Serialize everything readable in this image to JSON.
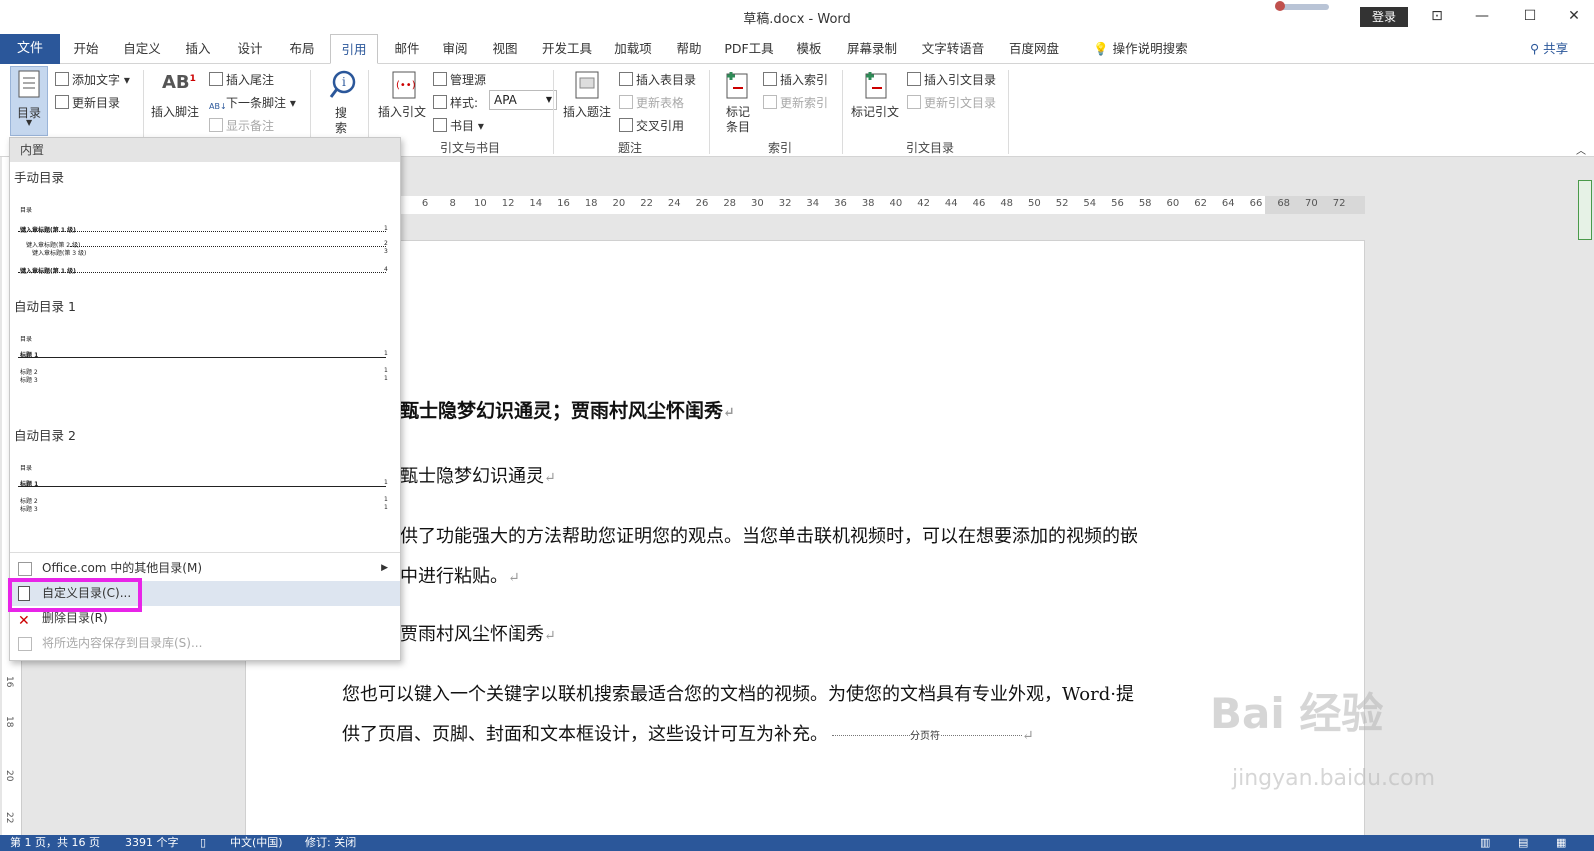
{
  "window": {
    "title": "草稿.docx  -  Word",
    "login": "登录"
  },
  "tabs": [
    "文件",
    "开始",
    "自定义",
    "插入",
    "设计",
    "布局",
    "引用",
    "邮件",
    "审阅",
    "视图",
    "开发工具",
    "加载项",
    "帮助",
    "PDF工具",
    "模板",
    "屏幕录制",
    "文字转语音",
    "百度网盘",
    "操作说明搜索"
  ],
  "share": "共享",
  "ribbon": {
    "toc_btn": "目录",
    "add_text": "添加文字",
    "update_toc": "更新目录",
    "insert_footnote": "插入脚注",
    "insert_endnote": "插入尾注",
    "next_footnote": "下一条脚注",
    "show_notes": "显示备注",
    "search_l1": "搜",
    "search_l2": "索",
    "insert_citation": "插入引文",
    "manage_sources": "管理源",
    "style_label": "样式:",
    "style_value": "APA",
    "bibliography": "书目",
    "group_citations": "引文与书目",
    "insert_caption": "插入题注",
    "insert_table_figures": "插入表目录",
    "update_table": "更新表格",
    "cross_ref": "交叉引用",
    "group_captions": "题注",
    "mark_entry_l1": "标记",
    "mark_entry_l2": "条目",
    "insert_index": "插入索引",
    "update_index": "更新索引",
    "group_index": "索引",
    "mark_citation": "标记引文",
    "insert_toa": "插入引文目录",
    "update_toa": "更新引文目录",
    "group_toa": "引文目录"
  },
  "ruler": {
    "ticks": [
      "6",
      "8",
      "10",
      "12",
      "14",
      "16",
      "18",
      "20",
      "22",
      "24",
      "26",
      "28",
      "30",
      "32",
      "34",
      "36",
      "38",
      "40",
      "42",
      "44",
      "46",
      "48",
      "50",
      "52",
      "54",
      "56",
      "58",
      "60",
      "62",
      "64",
      "66",
      "68",
      "70",
      "72"
    ]
  },
  "vruler": [
    "16",
    "18",
    "20",
    "22"
  ],
  "document": {
    "heading1": "甄士隐梦幻识通灵；贾雨村风尘怀闺秀",
    "heading2a": "甄士隐梦幻识通灵",
    "para1_line1": "供了功能强大的方法帮助您证明您的观点。当您单击联机视频时，可以在想要添加的视频的嵌",
    "para1_line2": "中进行粘贴。",
    "heading2b": "贾雨村风尘怀闺秀",
    "para2_line1": "您也可以键入一个关键字以联机搜索最适合您的文档的视频。为使您的文档具有专业外观，Word·提",
    "para2_line2": "供了页眉、页脚、封面和文本框设计，这些设计可互为补充。",
    "page_break": "分页符"
  },
  "dropdown": {
    "header": "内置",
    "manual": "手动目录",
    "auto1": "自动目录 1",
    "auto2": "自动目录 2",
    "pv_title": "目录",
    "pv_manual": [
      "键入章标题(第 1 级)",
      "键入章标题(第 2 级)",
      "键入章标题(第 3 级)",
      "键入章标题(第 1 级)"
    ],
    "pv_manual_nums": [
      "1",
      "2",
      "3",
      "4"
    ],
    "pv_auto": [
      "标题 1",
      "标题 2",
      "标题 3"
    ],
    "pv_auto_nums": [
      "1",
      "1",
      "1"
    ],
    "more_office": "Office.com 中的其他目录(M)",
    "custom_toc": "自定义目录(C)...",
    "remove_toc": "删除目录(R)",
    "save_selection": "将所选内容保存到目录库(S)..."
  },
  "status": {
    "page": "第 1 页，共 16 页",
    "words": "3391 个字",
    "lang": "中文(中国)",
    "track": "修订: 关闭"
  },
  "watermark": {
    "brand": "Bai 经验",
    "url": "jingyan.baidu.com"
  },
  "colors": {
    "accent": "#2b579a",
    "highlight": "#e824e8"
  }
}
